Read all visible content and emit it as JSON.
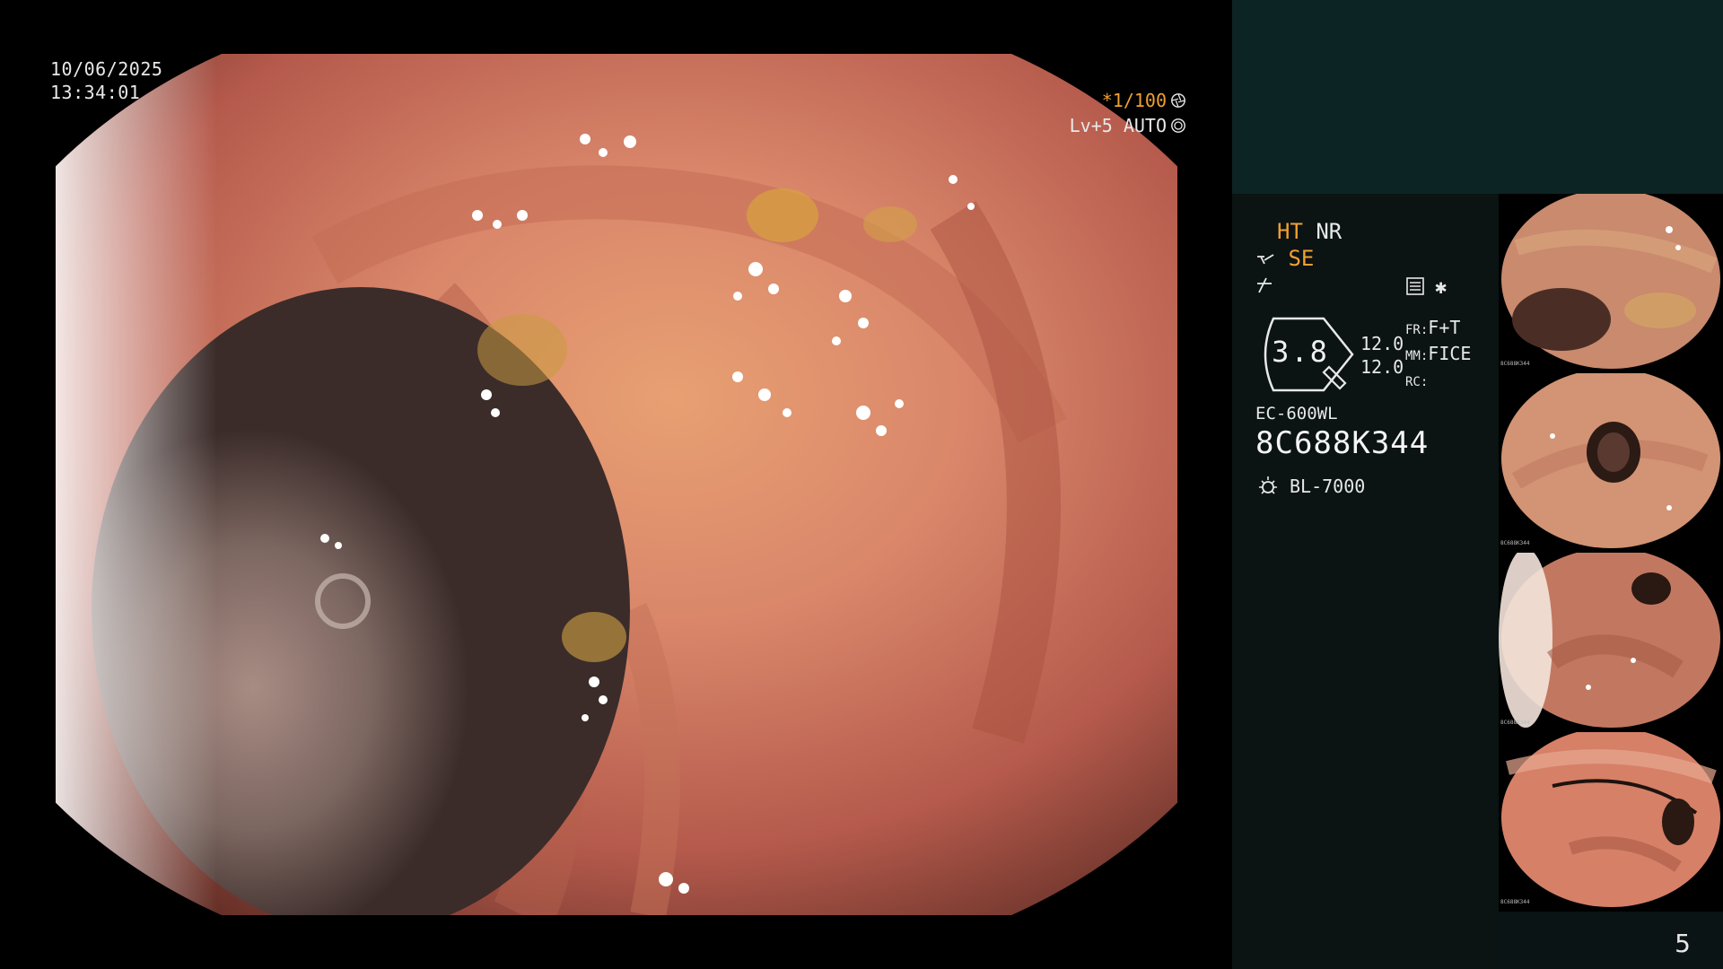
{
  "main": {
    "date": "10/06/2025",
    "time": "13:34:01",
    "shutter": "*1/100",
    "level": "Lv+5 AUTO"
  },
  "panel": {
    "ht": "HT",
    "nr": "NR",
    "se": "SE",
    "gauge_value": "3.8",
    "param_values": [
      "12.0",
      "12.0"
    ],
    "param_labels": [
      "FR:",
      "MM:",
      "RC:"
    ],
    "param_settings": [
      "F+T",
      "FICE",
      ""
    ],
    "scope_model": "EC-600WL",
    "scope_serial": "8C688K344",
    "light_source": "BL-7000",
    "page_number": "5"
  },
  "icons": {
    "shutter": "aperture-icon",
    "auto": "exposure-icon",
    "se": "structure-enhance-icon",
    "edge": "edge-icon",
    "settings": "memory-settings-icon",
    "star": "asterisk-icon",
    "light": "light-source-icon"
  },
  "thumbnails": [
    {
      "serial": "8C688K344"
    },
    {
      "serial": "8C688K344"
    },
    {
      "serial": "8C688K344"
    },
    {
      "serial": "8C688K344"
    }
  ],
  "colors": {
    "accent_orange": "#f0a030",
    "panel_bg": "#0b1414",
    "panel_top": "#0d2424",
    "text": "#e8e8e8"
  }
}
